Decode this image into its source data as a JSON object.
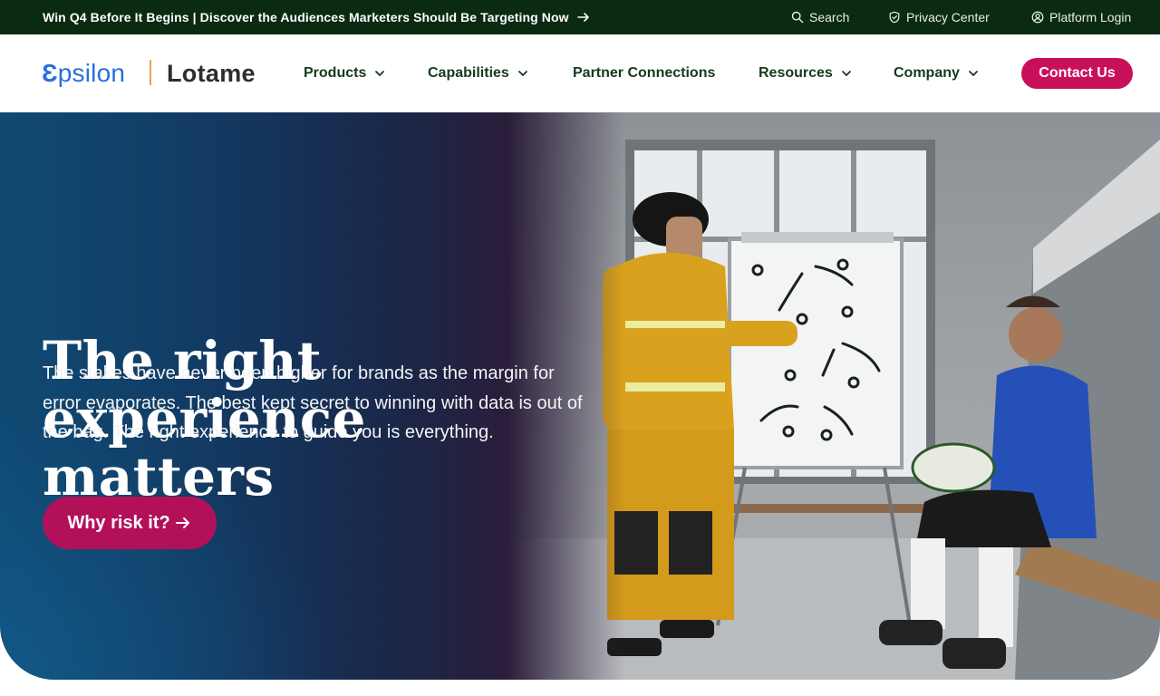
{
  "topbar": {
    "promo_text": "Win Q4 Before It Begins | Discover the Audiences Marketers Should Be Targeting Now",
    "search_label": "Search",
    "privacy_label": "Privacy Center",
    "login_label": "Platform Login"
  },
  "brand": {
    "epsilon_rest": "psilon",
    "epsilon_first": "Ɛ",
    "lotame": "Lotame"
  },
  "nav": {
    "products": "Products",
    "capabilities": "Capabilities",
    "partner": "Partner Connections",
    "resources": "Resources",
    "company": "Company",
    "contact": "Contact Us"
  },
  "hero": {
    "title_line1": "The right",
    "title_line2": "experience matters",
    "body": "The stakes have never been higher for brands as the margin for error evaporates. The best kept secret to winning with data is out of the bag. The right experience to guide you is everything.",
    "cta": "Why risk it?"
  },
  "colors": {
    "topbar_bg": "#0b2a12",
    "brand_blue": "#2a6ee0",
    "brand_divider": "#e2a54a",
    "nav_text": "#163a1d",
    "accent_magenta": "#c8105a"
  },
  "icons": {
    "promo_arrow": "arrow-right-icon",
    "search": "search-icon",
    "privacy": "shield-icon",
    "login": "user-circle-icon",
    "nav_chevron": "chevron-down-icon",
    "cta_arrow": "arrow-right-icon"
  }
}
